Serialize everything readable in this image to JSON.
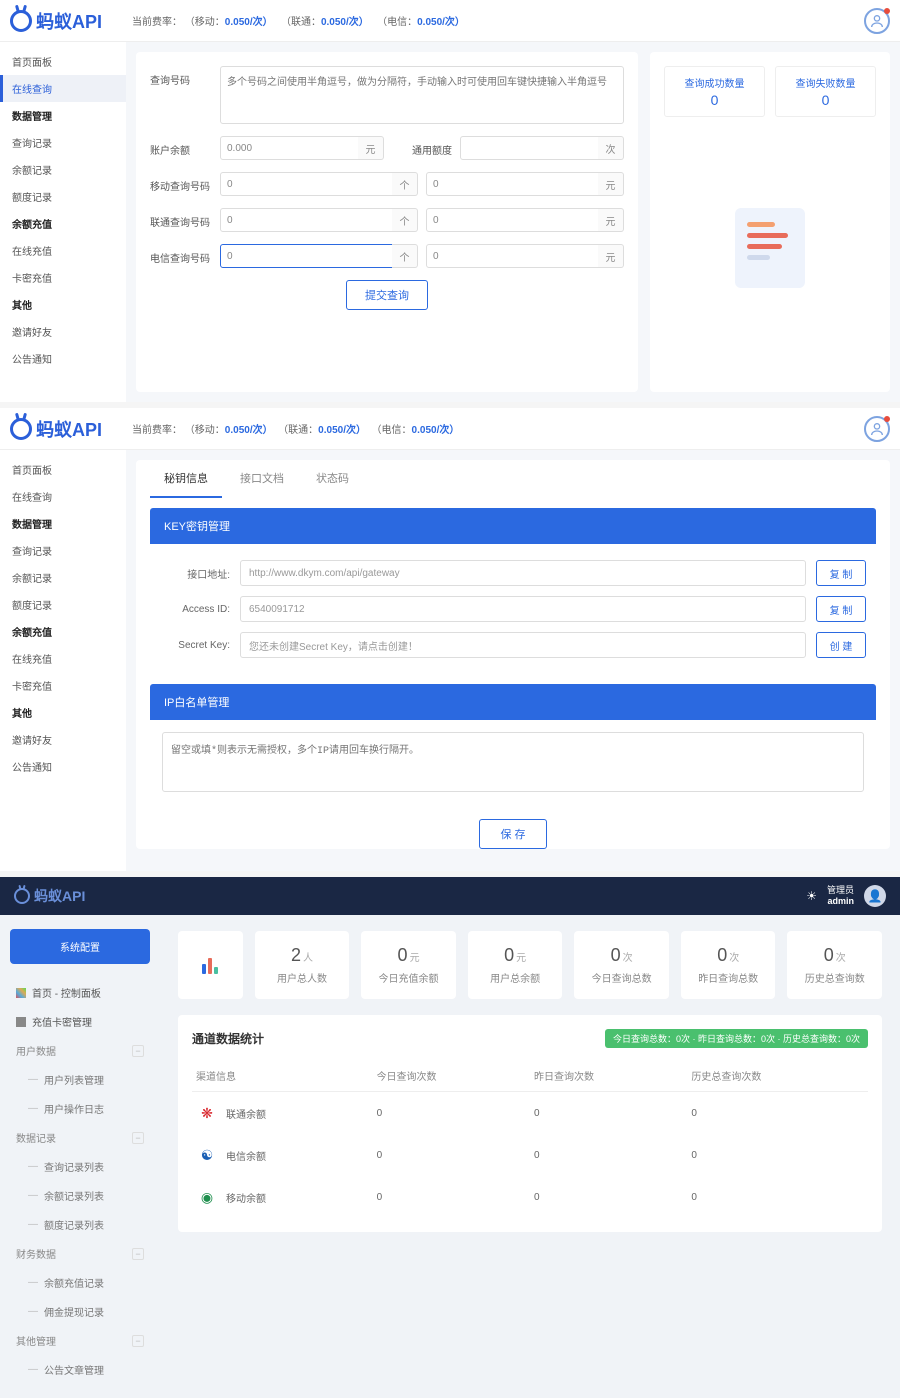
{
  "logo_text": "蚂蚁API",
  "rate": {
    "prefix": "当前费率：",
    "mobile_lbl": "（移动：",
    "mobile_val": "0.050/次）",
    "unicom_lbl": "（联通：",
    "unicom_val": "0.050/次）",
    "telecom_lbl": "（电信：",
    "telecom_val": "0.050/次）"
  },
  "sidebar1": {
    "home": "首页面板",
    "online": "在线查询",
    "data_hdr": "数据管理",
    "query_rec": "查询记录",
    "balance_rec": "余额记录",
    "quota_rec": "额度记录",
    "recharge_hdr": "余额充值",
    "online_recharge": "在线充值",
    "card_recharge": "卡密充值",
    "other_hdr": "其他",
    "invite": "邀请好友",
    "notice": "公告通知"
  },
  "form": {
    "query_label": "查询号码",
    "query_ph": "多个号码之间使用半角逗号，做为分隔符，手动输入时可使用回车键快捷输入半角逗号",
    "acct_label": "账户余额",
    "acct_val": "0.000",
    "acct_unit": "元",
    "quota_label": "通用额度",
    "quota_val": "",
    "quota_unit": "次",
    "mobile_label": "移动查询号码",
    "mobile_cnt": "0",
    "mobile_unit1": "个",
    "mobile_amt": "0",
    "mobile_unit2": "元",
    "unicom_label": "联通查询号码",
    "unicom_cnt": "0",
    "unicom_unit1": "个",
    "unicom_amt": "0",
    "unicom_unit2": "元",
    "telecom_label": "电信查询号码",
    "telecom_cnt": "0",
    "telecom_unit1": "个",
    "telecom_amt": "0",
    "telecom_unit2": "元",
    "submit": "提交查询"
  },
  "stats": {
    "success_lbl": "查询成功数量",
    "success_val": "0",
    "fail_lbl": "查询失败数量",
    "fail_val": "0"
  },
  "tabs": {
    "t1": "秘钥信息",
    "t2": "接口文档",
    "t3": "状态码"
  },
  "key_panel": {
    "title": "KEY密钥管理",
    "url_lbl": "接口地址:",
    "url_val": "http://www.dkym.com/api/gateway",
    "id_lbl": "Access ID:",
    "id_val": "6540091712",
    "sk_lbl": "Secret Key:",
    "sk_val": "您还未创建Secret Key，请点击创建！",
    "copy": "复 制",
    "create": "创 建"
  },
  "ip_panel": {
    "title": "IP白名单管理",
    "ph": "留空或填*则表示无需授权，多个IP请用回车换行隔开。",
    "save": "保 存"
  },
  "admin": {
    "role": "管理员",
    "name": "admin",
    "sys_btn": "系统配置",
    "nav": {
      "dashboard": "首页 - 控制面板",
      "card": "充值卡密管理",
      "user_hdr": "用户数据",
      "user_list": "用户列表管理",
      "user_log": "用户操作日志",
      "data_hdr": "数据记录",
      "query_list": "查询记录列表",
      "balance_list": "余额记录列表",
      "quota_list": "额度记录列表",
      "fin_hdr": "财务数据",
      "recharge_rec": "余额充值记录",
      "commission_rec": "佣金提现记录",
      "other_hdr": "其他管理",
      "article": "公告文章管理"
    },
    "metrics": {
      "users_val": "2",
      "users_unit": "人",
      "users_lbl": "用户总人数",
      "today_bal_val": "0",
      "today_bal_unit": "元",
      "today_bal_lbl": "今日充值余额",
      "user_bal_val": "0",
      "user_bal_unit": "元",
      "user_bal_lbl": "用户总余额",
      "today_q_val": "0",
      "today_q_unit": "次",
      "today_q_lbl": "今日查询总数",
      "yest_q_val": "0",
      "yest_q_unit": "次",
      "yest_q_lbl": "昨日查询总数",
      "hist_q_val": "0",
      "hist_q_unit": "次",
      "hist_q_lbl": "历史总查询数"
    },
    "channel": {
      "title": "通道数据统计",
      "badge": "今日查询总数：0次 · 昨日查询总数：0次 · 历史总查询数：0次",
      "col1": "渠道信息",
      "col2": "今日查询次数",
      "col3": "昨日查询次数",
      "col4": "历史总查询次数",
      "r1_name": "联通余额",
      "r1_a": "0",
      "r1_b": "0",
      "r1_c": "0",
      "r2_name": "电信余额",
      "r2_a": "0",
      "r2_b": "0",
      "r2_c": "0",
      "r3_name": "移动余额",
      "r3_a": "0",
      "r3_b": "0",
      "r3_c": "0"
    }
  }
}
